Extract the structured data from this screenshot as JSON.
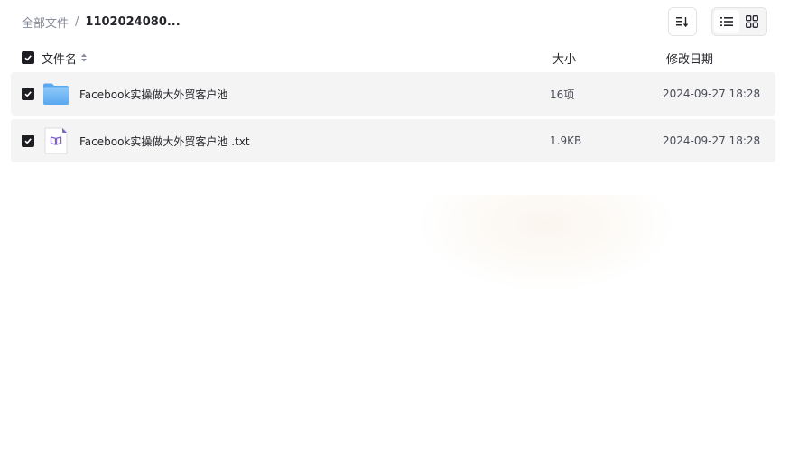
{
  "breadcrumb": {
    "root": "全部文件",
    "separator": "/",
    "current": "1102024080..."
  },
  "toolbar": {
    "sort_icon": "sort-icon",
    "list_view_icon": "list-view-icon",
    "grid_view_icon": "grid-view-icon",
    "active_view": "list"
  },
  "table": {
    "headers": {
      "name": "文件名",
      "size": "大小",
      "modified": "修改日期"
    },
    "rows": [
      {
        "icon": "folder-icon",
        "name": "Facebook实操做大外贸客户池",
        "size": "16项",
        "modified": "2024-09-27 18:28",
        "checked": true
      },
      {
        "icon": "text-file-icon",
        "name": "Facebook实操做大外贸客户池 .txt",
        "size": "1.9KB",
        "modified": "2024-09-27 18:28",
        "checked": true
      }
    ]
  },
  "colors": {
    "accent_folder": "#6fb6f5",
    "file_icon": "#7b61c9",
    "row_bg": "#f4f4f5",
    "checkbox": "#1d1e22"
  }
}
